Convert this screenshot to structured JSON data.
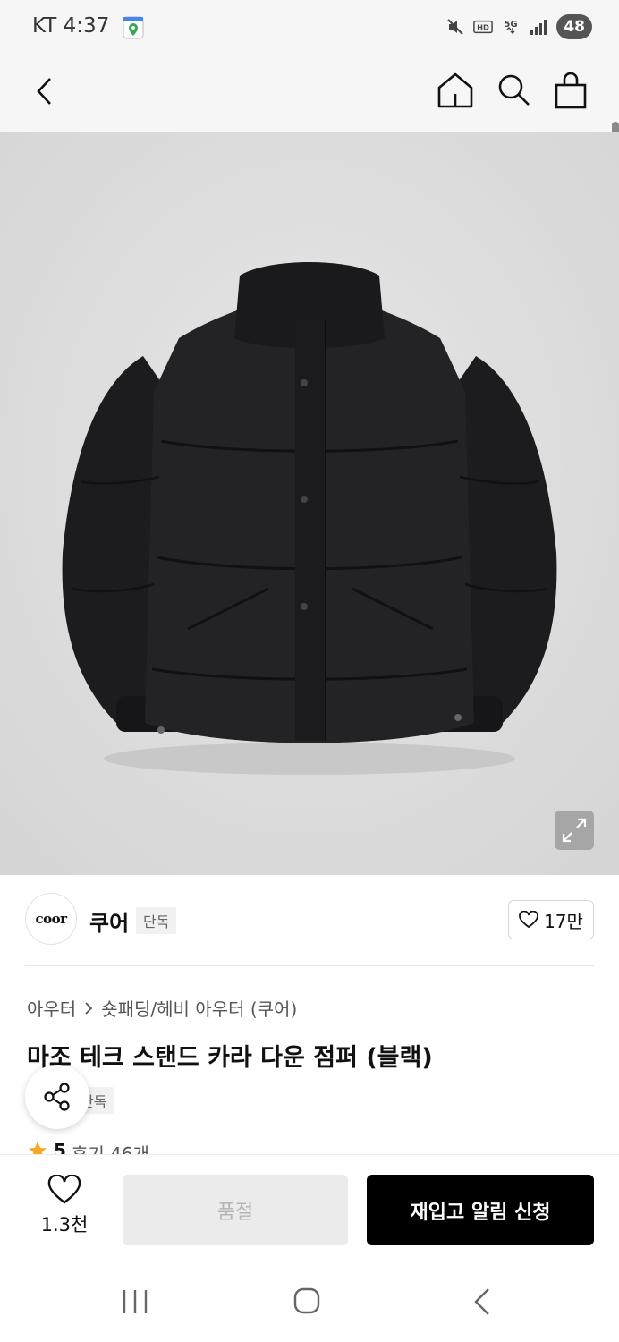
{
  "status_bar": {
    "carrier": "KT",
    "time": "4:37",
    "network": "5G",
    "quality": "HD",
    "battery": "48"
  },
  "header": {
    "back_icon": "chevron-left-icon",
    "home_icon": "home-icon",
    "search_icon": "search-icon",
    "cart_icon": "shopping-bag-icon"
  },
  "product_image": {
    "subject": "black puffer down jacket",
    "background_color": "#dcdcdc",
    "zoom_icon": "expand-icon"
  },
  "brand": {
    "logo_text": "coor",
    "name": "쿠어",
    "tag": "단독",
    "likes": "17만"
  },
  "product": {
    "breadcrumb": [
      "아우터",
      "숏패딩/헤비 아우터 (쿠어)"
    ],
    "title": "마조 테크 스탠드 카라 다운 점퍼 (블랙)",
    "tag": "단독",
    "rating": "5",
    "reviews": "후기 46개"
  },
  "actions": {
    "wish_count": "1.3천",
    "soldout_label": "품절",
    "restock_label": "재입고 알림 신청"
  },
  "colors": {
    "primary_button": "#000000",
    "disabled_button": "#ebebeb",
    "star": "#f5a623"
  }
}
